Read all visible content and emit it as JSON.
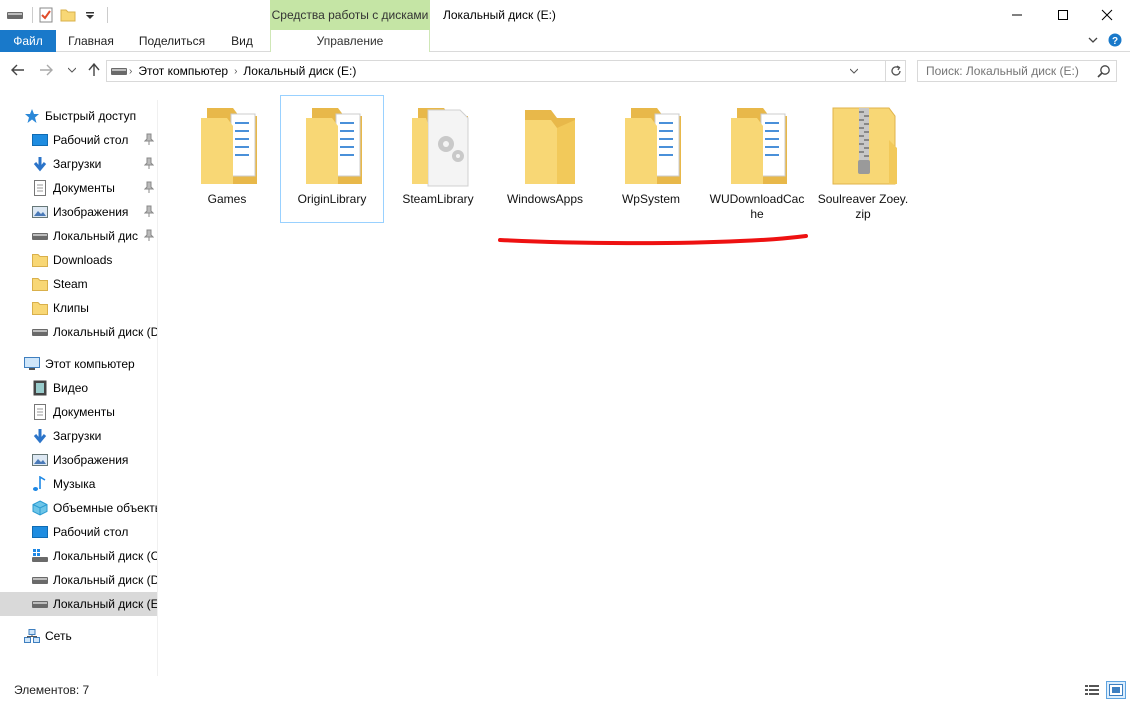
{
  "window": {
    "title": "Локальный диск (E:)",
    "tools_group": "Средства работы с дисками"
  },
  "ribbon": {
    "tabs": [
      "Файл",
      "Главная",
      "Поделиться",
      "Вид"
    ],
    "tools_tab": "Управление"
  },
  "address": {
    "crumbs": [
      "Этот компьютер",
      "Локальный диск (E:)"
    ],
    "search_placeholder": "Поиск: Локальный диск (E:)"
  },
  "sidebar": {
    "quick_access": {
      "label": "Быстрый доступ",
      "items": [
        {
          "label": "Рабочий стол",
          "icon": "desktop-icon",
          "pinned": true
        },
        {
          "label": "Загрузки",
          "icon": "download-icon",
          "pinned": true
        },
        {
          "label": "Документы",
          "icon": "documents-icon",
          "pinned": true
        },
        {
          "label": "Изображения",
          "icon": "pictures-icon",
          "pinned": true
        },
        {
          "label": "Локальный дис",
          "icon": "drive-icon",
          "pinned": true
        },
        {
          "label": "Downloads",
          "icon": "folder-icon",
          "pinned": false
        },
        {
          "label": "Steam",
          "icon": "folder-icon",
          "pinned": false
        },
        {
          "label": "Клипы",
          "icon": "folder-icon",
          "pinned": false
        },
        {
          "label": "Локальный диск (D",
          "icon": "drive-icon",
          "pinned": false
        }
      ]
    },
    "this_pc": {
      "label": "Этот компьютер",
      "items": [
        {
          "label": "Видео",
          "icon": "video-icon"
        },
        {
          "label": "Документы",
          "icon": "documents-icon"
        },
        {
          "label": "Загрузки",
          "icon": "download-icon"
        },
        {
          "label": "Изображения",
          "icon": "pictures-icon"
        },
        {
          "label": "Музыка",
          "icon": "music-icon"
        },
        {
          "label": "Объемные объекты",
          "icon": "3d-objects-icon"
        },
        {
          "label": "Рабочий стол",
          "icon": "desktop-icon"
        },
        {
          "label": "Локальный диск (C",
          "icon": "system-drive-icon"
        },
        {
          "label": "Локальный диск (D",
          "icon": "drive-icon"
        },
        {
          "label": "Локальный диск (E",
          "icon": "drive-icon",
          "selected": true
        }
      ]
    },
    "network": {
      "label": "Сеть"
    }
  },
  "files": [
    {
      "name": "Games",
      "type": "folder"
    },
    {
      "name": "OriginLibrary",
      "type": "folder",
      "focused": true
    },
    {
      "name": "SteamLibrary",
      "type": "settings-folder"
    },
    {
      "name": "WindowsApps",
      "type": "empty-folder"
    },
    {
      "name": "WpSystem",
      "type": "folder"
    },
    {
      "name": "WUDownloadCache",
      "type": "folder"
    },
    {
      "name": "Soulreaver Zoey.zip",
      "type": "zip"
    }
  ],
  "status": {
    "item_count": "Элементов: 7"
  },
  "colors": {
    "accent": "#1979ca",
    "tools_tab": "#c5e5a5",
    "folder": "#f8d775",
    "annotation_line": "#ee1111"
  }
}
